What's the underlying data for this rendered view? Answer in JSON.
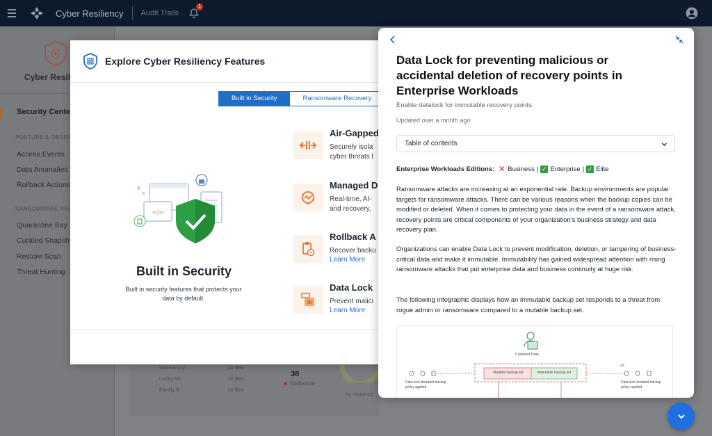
{
  "topbar": {
    "app_name": "Cyber Resiliency",
    "crumb": "Audit Trails",
    "notification_count": "1"
  },
  "sidebar": {
    "brand": "Cyber Resil",
    "security_center": "Security Center",
    "group_posture": "POSTURE & OBSERV",
    "posture_items": [
      "Access Events",
      "Data Anomalies",
      "Rollback Actions"
    ],
    "group_ransomware": "RANSOMWARE REC",
    "ransomware_items": [
      "Quarantine Bay",
      "Curated Snapsh",
      "Restore Scan",
      "Threat Hunting"
    ]
  },
  "background": {
    "rows": [
      {
        "name": "Wanna Cry",
        "files": "24 files"
      },
      {
        "name": "Locky Bit",
        "files": "18 files"
      },
      {
        "name": "Family 3",
        "files": "14 files"
      }
    ],
    "endpoints_count": "38",
    "endpoints_label": "Endpoints",
    "by_resource": "by resource"
  },
  "modal": {
    "title": "Explore Cyber Resiliency Features",
    "tabs": [
      "Built in Security",
      "Ransomware Recovery"
    ],
    "feature_title": "Built in Security",
    "feature_desc": "Built in security features that protects your data by default.",
    "items": [
      {
        "title": "Air-Gapped",
        "desc1": "Securely isola",
        "desc2": "cyber threats l"
      },
      {
        "title": "Managed D",
        "desc1": "Real-time, AI-",
        "desc2": "and recovery,"
      },
      {
        "title": "Rollback A",
        "desc1": "Recover backu",
        "link": "Learn More"
      },
      {
        "title": "Data Lock",
        "desc1": "Prevent malici",
        "link": "Learn More"
      }
    ],
    "accent": "#1f6fc7"
  },
  "panel": {
    "title": "Data Lock for preventing malicious or accidental deletion of recovery points in Enterprise Workloads",
    "subtitle": "Enable datalock for immutable recovery points.",
    "updated": "Updated over a month ago",
    "toc": "Table of contents",
    "editions_label": "Enterprise Workloads Editions:",
    "editions": [
      {
        "name": "Business",
        "status": "no"
      },
      {
        "name": "Enterprise",
        "status": "yes"
      },
      {
        "name": "Elite",
        "status": "yes"
      }
    ],
    "para1": "Ransomware attacks are increasing at an exponential rate. Backup environments are popular targets for ransomware attacks. There can be various reasons when the backup copies can be modified or deleted. When it comes to protecting your data in the event of a ransomware attack, recovery points are critical components of your organization's business strategy and data recovery plan.",
    "para2": "Organizations can enable Data Lock to prevent modification, deletion, or tampering of business-critical data and make it immutable. Immutability has gained widespread attention with rising ransomware attacks that put enterprise data and business continuity at huge risk.",
    "para3": "The following infographic displays how an immutable backup set responds to a threat from rogue admin or ransomware compared to a mutable backup set.",
    "infographic": {
      "customer_data": "Customer Data",
      "mutable": "Mutable backup set",
      "immutable": "Immutable backup set",
      "left_note": "Data lock-disabled backup policy applied",
      "right_note": "Data lock-enabled backup policy applied"
    }
  },
  "icons": {
    "menu": "hamburger-menu-icon",
    "bell": "bell-icon",
    "user": "user-avatar-icon",
    "back": "chevron-left-icon",
    "collapse": "collapse-arrows-icon",
    "fab": "chevron-down-icon"
  }
}
